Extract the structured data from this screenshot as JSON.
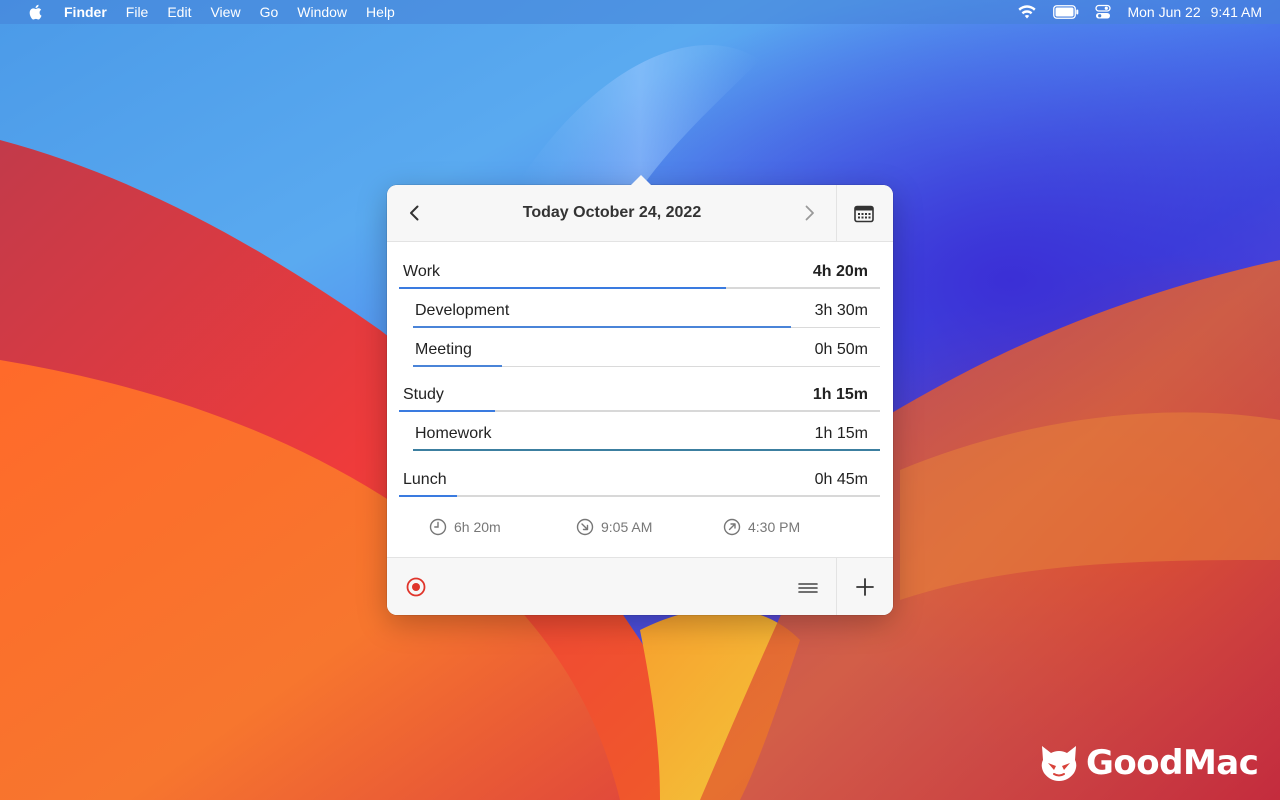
{
  "menubar": {
    "app_name": "Finder",
    "items": [
      "File",
      "Edit",
      "View",
      "Go",
      "Window",
      "Help"
    ],
    "date": "Mon Jun 22",
    "time": "9:41 AM"
  },
  "popover": {
    "title": "Today October 24, 2022",
    "entries": [
      {
        "label": "Work",
        "duration": "4h 20m",
        "progress": 0.68,
        "level": "category"
      },
      {
        "label": "Development",
        "duration": "3h 30m",
        "progress": 0.81,
        "level": "task"
      },
      {
        "label": "Meeting",
        "duration": "0h 50m",
        "progress": 0.19,
        "level": "task"
      },
      {
        "label": "Study",
        "duration": "1h 15m",
        "progress": 0.2,
        "level": "category"
      },
      {
        "label": "Homework",
        "duration": "1h 15m",
        "progress": 1.0,
        "level": "task"
      },
      {
        "label": "Lunch",
        "duration": "0h 45m",
        "progress": 0.12,
        "level": "category"
      }
    ],
    "stats": {
      "total": "6h 20m",
      "start": "9:05 AM",
      "end": "4:30 PM"
    }
  },
  "colors": {
    "accent": "#3a7be0",
    "record": "#e0352b"
  },
  "watermark": {
    "text": "GoodMac"
  }
}
